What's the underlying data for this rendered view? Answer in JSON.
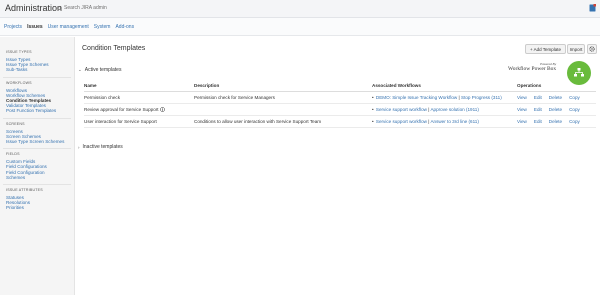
{
  "header": {
    "title": "Administration",
    "search_placeholder": "Search JIRA admin"
  },
  "nav": {
    "tabs": [
      "Projects",
      "Issues",
      "User management",
      "System",
      "Add-ons"
    ]
  },
  "sidebar": {
    "sections": [
      {
        "heading": "ISSUE TYPES",
        "items": [
          "Issue Types",
          "Issue Type Schemes",
          "Sub-Tasks"
        ]
      },
      {
        "heading": "WORKFLOWS",
        "items": [
          "Workflows",
          "Workflow Schemes",
          "Condition Templates",
          "Validator Templates",
          "Post Function Templates"
        ]
      },
      {
        "heading": "SCREENS",
        "items": [
          "Screens",
          "Screen Schemes",
          "Issue Type Screen Schemes"
        ]
      },
      {
        "heading": "FIELDS",
        "items": [
          "Custom Fields",
          "Field Configurations",
          "Field Configuration Schemes"
        ]
      },
      {
        "heading": "ISSUE ATTRIBUTES",
        "items": [
          "Statuses",
          "Resolutions",
          "Priorities"
        ]
      }
    ]
  },
  "main": {
    "title": "Condition Templates",
    "add_button": "+ Add Template",
    "import_button": "Import",
    "active_label": "Active templates",
    "inactive_label": "Inactive templates",
    "logo_small": "Powered By",
    "logo_big": "Workflow Power Box",
    "columns": [
      "Name",
      "Description",
      "Associated Workflows",
      "Operations"
    ],
    "rows": [
      {
        "name": "Permission check",
        "description": "Permission check for Service Managers",
        "workflows": "DEMO: Simple Issue Tracking Workflow",
        "transitions": "Stop Progress (311)",
        "ops": [
          "View",
          "Edit",
          "Delete",
          "Copy"
        ]
      },
      {
        "name": "Review approval for Service Support",
        "description": "",
        "workflows": "Service support workflow",
        "transitions": "Approve solution (1911)",
        "ops": [
          "View",
          "Edit",
          "Delete",
          "Copy"
        ]
      },
      {
        "name": "User interaction for Service Support",
        "description": "Conditions to allow user interaction with Service Support Team",
        "workflows": "Service support workflow",
        "transitions": "Answer to 3rd line (611)",
        "ops": [
          "View",
          "Edit",
          "Delete",
          "Copy"
        ]
      }
    ]
  }
}
